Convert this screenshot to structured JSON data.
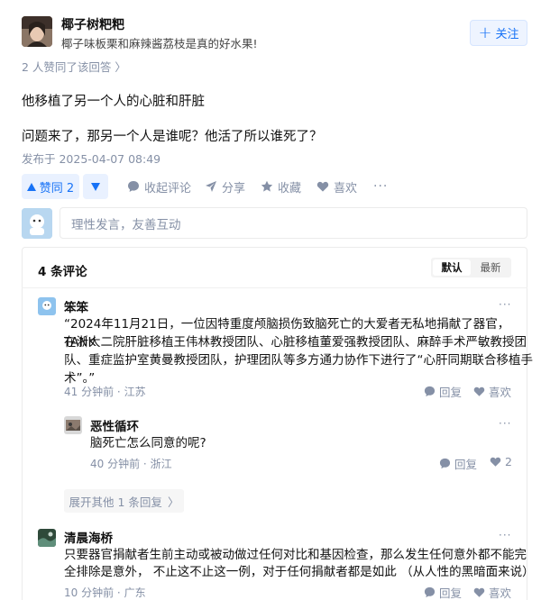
{
  "author": {
    "name": "椰子树粑粑",
    "bio": "椰子味板栗和麻辣酱荔枝是真的好水果!",
    "follow_label": "关注"
  },
  "voters_text": "2 人赞同了该回答 〉",
  "answer": {
    "line1": "他移植了另一个人的心脏和肝脏",
    "line2": "问题来了，那另一个人是谁呢？他活了所以谁死了？",
    "publish_time": "发布于 2025-04-07 08:49"
  },
  "actions": {
    "upvote": "赞同 2",
    "collapse_comments": "收起评论",
    "share": "分享",
    "favorite": "收藏",
    "like": "喜欢",
    "more": "···"
  },
  "comment_input": {
    "placeholder": "理性发言，友善互动"
  },
  "comments_panel": {
    "count_label": "4 条评论",
    "sort_default": "默认",
    "sort_newest": "最新",
    "comments": [
      {
        "user": "笨笨",
        "lines": [
          "“2024年11月21日，一位因特重度颅脑损伤致脑死亡的大爱者无私地捐献了器官，TANK",
          "在浙大二院肝脏移植王伟林教授团队、心脏移植董爱强教授团队、麻醉手术严敏教授团",
          "队、重症监护室黄曼教授团队，护理团队等多方通力协作下进行了“心肝同期联合移植手",
          "术”。”"
        ],
        "time": "41 分钟前",
        "location": "江苏",
        "reply_label": "回复",
        "like_label": "喜欢",
        "more": "···"
      },
      {
        "user": "恶性循环",
        "text": "脑死亡怎么同意的呢?",
        "time": "40 分钟前",
        "location": "浙江",
        "reply_label": "回复",
        "like_count": "2",
        "more": "···"
      },
      {
        "user": "清晨海桥",
        "lines": [
          "只要器官捐献者生前主动或被动做过任何对比和基因检查，那么发生任何意外都不能完",
          "全排除是意外， 不止这不止这一例，对于任何捐献者都是如此 （从人性的黑暗面来说）"
        ],
        "time": "10 分钟前",
        "location": "广东",
        "reply_label": "回复",
        "like_label": "喜欢",
        "more": "···"
      }
    ],
    "expand_replies": "展开其他 1 条回复",
    "expand_chevron": "〉"
  },
  "colors": {
    "accent": "#1772f6",
    "muted": "#8590a6",
    "accent_bg": "#e9f1ff"
  },
  "icons": [
    "plus-icon",
    "triangle-up-icon",
    "triangle-down-icon",
    "comment-bubble-icon",
    "share-arrow-icon",
    "star-icon",
    "heart-icon",
    "more-icon"
  ]
}
